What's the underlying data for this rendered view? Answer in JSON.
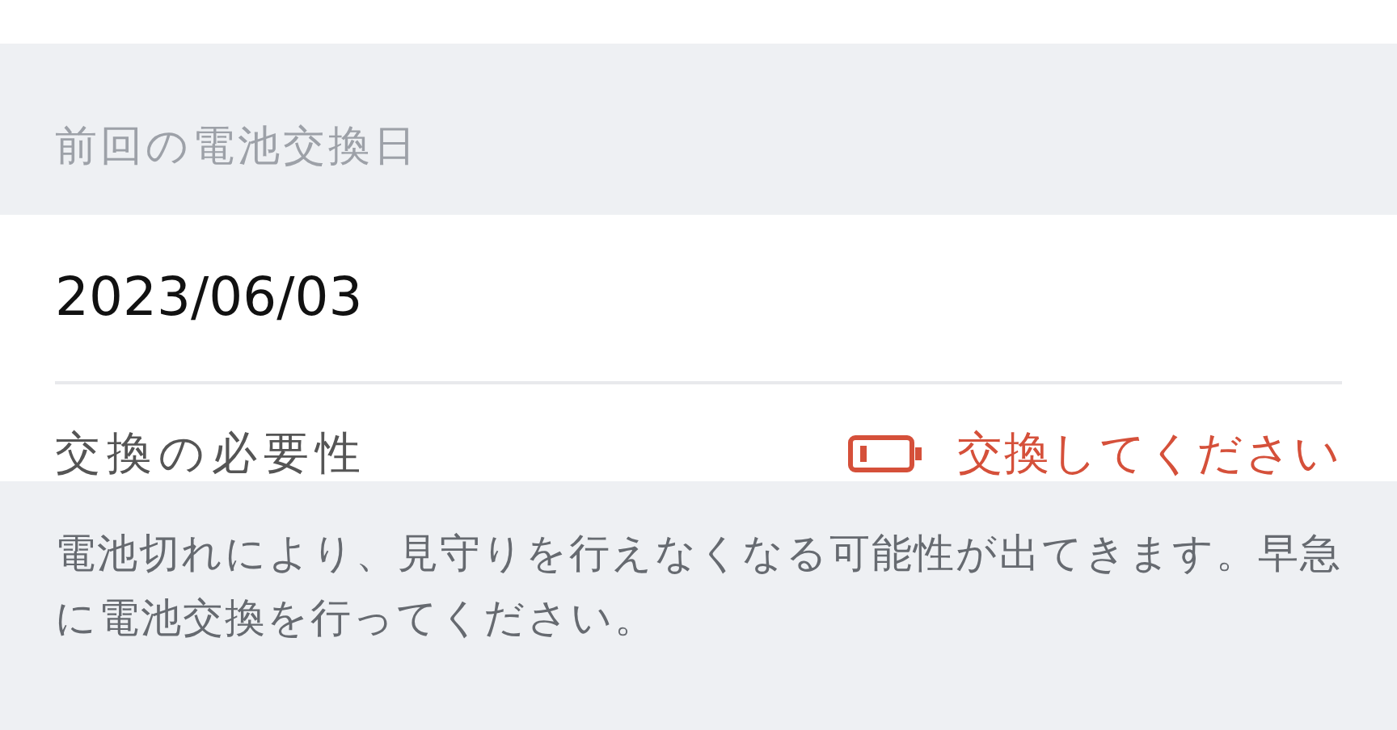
{
  "section_header": "前回の電池交換日",
  "last_change_date": "2023/06/03",
  "need": {
    "label": "交換の必要性",
    "value": "交換してください",
    "kind": "warning"
  },
  "note": "電池切れにより、見守りを行えなくなる可能性が出てきます。早急に電池交換を行ってください。"
}
